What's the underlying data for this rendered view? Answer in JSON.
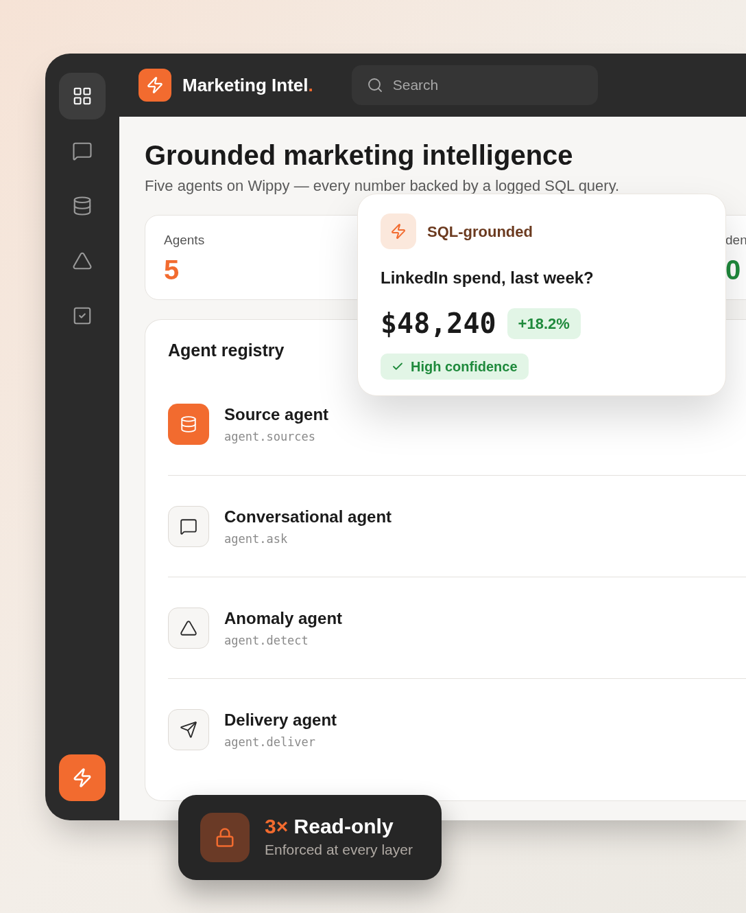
{
  "brand": {
    "name": "Marketing Intel",
    "mark": "."
  },
  "search": {
    "placeholder": "Search"
  },
  "sidebar": {
    "items": [
      {
        "selected": true
      },
      {
        "selected": false
      },
      {
        "selected": false
      },
      {
        "selected": false
      },
      {
        "selected": false
      }
    ]
  },
  "header": {
    "title": "Grounded marketing intelligence",
    "subtitle": "Five agents on Wippy — every number backed by a logged SQL query."
  },
  "stats": [
    {
      "label": "Agents",
      "value": "5",
      "color": "#f26b2f"
    },
    {
      "label": "den",
      "value": "0",
      "color": "#1f8a3c"
    }
  ],
  "registry": {
    "title": "Agent registry",
    "agents": [
      {
        "name": "Source agent",
        "id": "agent.sources",
        "highlighted": true
      },
      {
        "name": "Conversational agent",
        "id": "agent.ask",
        "highlighted": false
      },
      {
        "name": "Anomaly agent",
        "id": "agent.detect",
        "highlighted": false
      },
      {
        "name": "Delivery agent",
        "id": "agent.deliver",
        "highlighted": false
      }
    ]
  },
  "answer_card": {
    "tag": "SQL-grounded",
    "question": "LinkedIn spend, last week?",
    "value": "$48,240",
    "delta": "+18.2%",
    "confidence": "High confidence"
  },
  "toast": {
    "multiplier": "3×",
    "title": "Read-only",
    "subtitle": "Enforced at every layer"
  }
}
